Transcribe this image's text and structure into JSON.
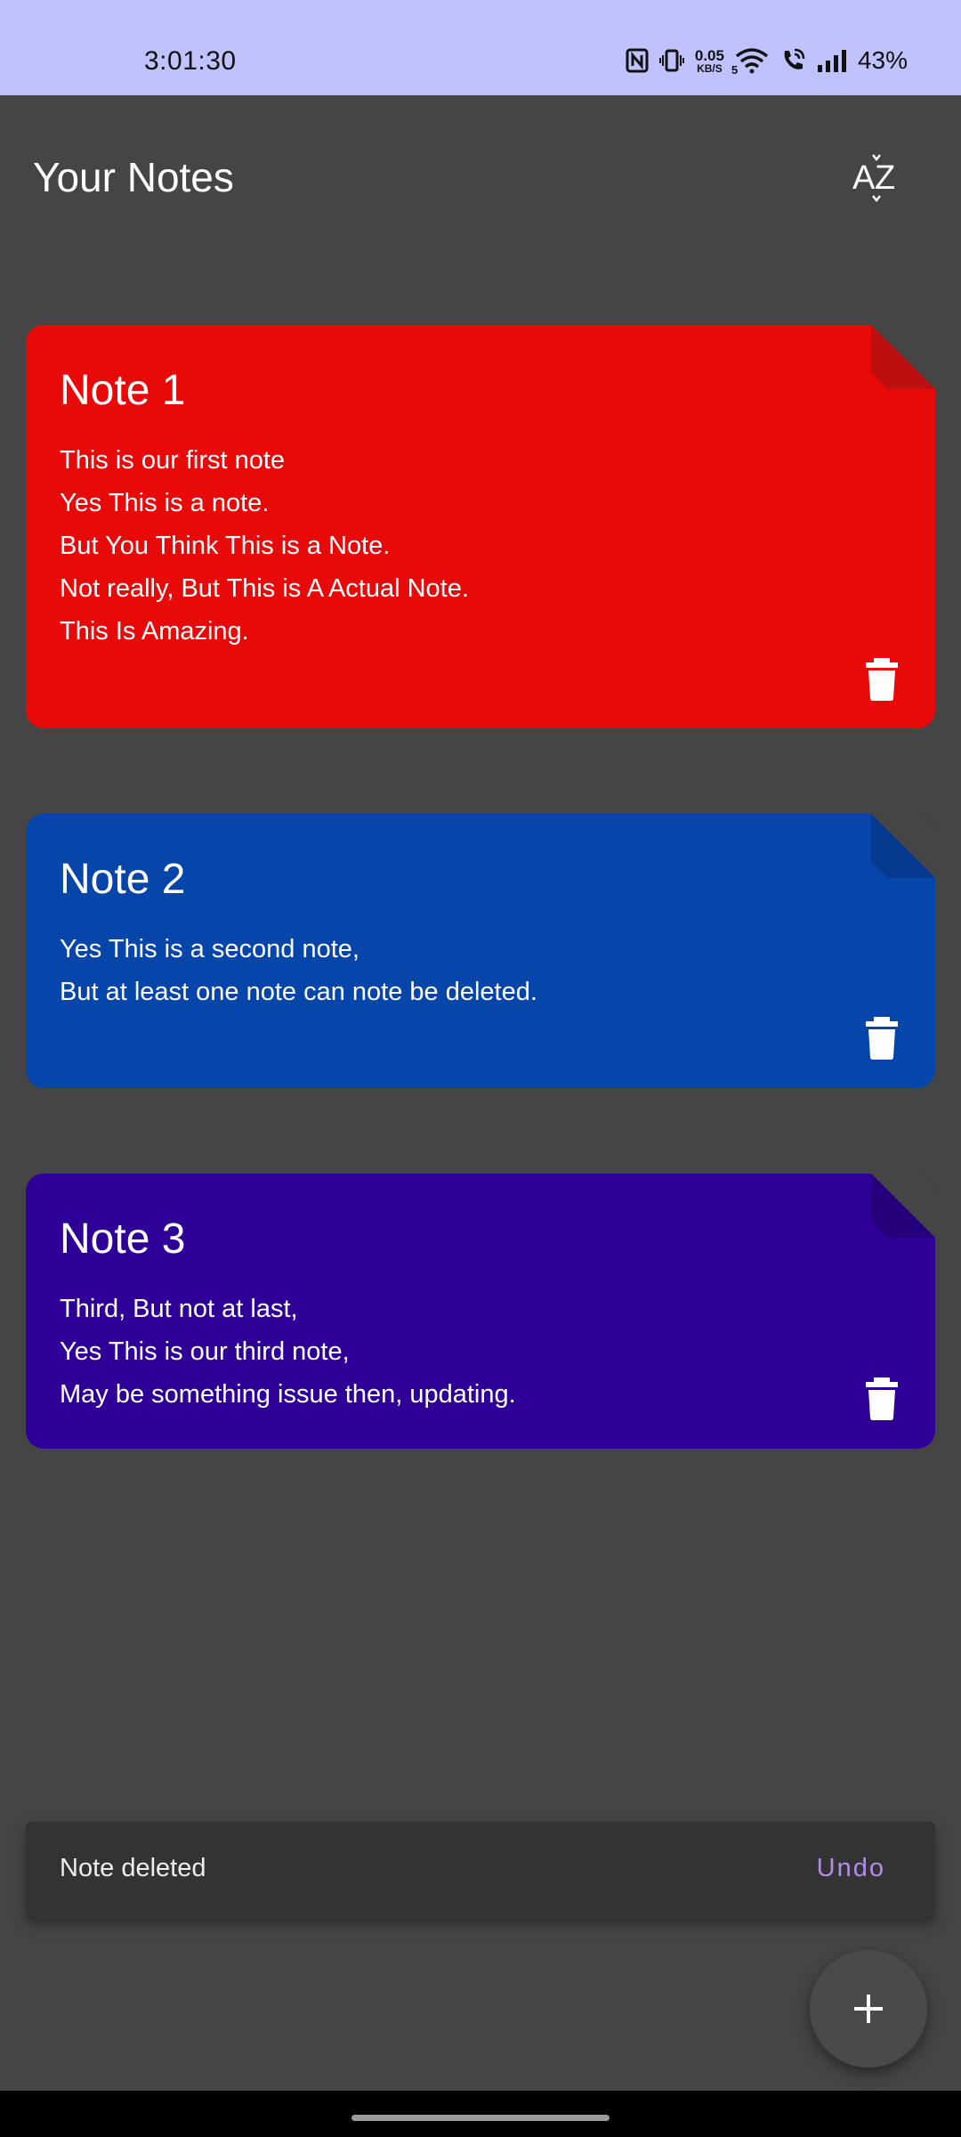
{
  "status_bar": {
    "time": "3:01:30",
    "net_speed_value": "0.05",
    "net_speed_unit": "KB/S",
    "wifi_badge": "5",
    "battery": "43%"
  },
  "header": {
    "title": "Your Notes",
    "sort_icon": "sort-az-icon"
  },
  "notes": [
    {
      "title": "Note 1",
      "lines": [
        "This is our first note",
        "Yes This is a note.",
        "But You Think This is a Note.",
        "Not really, But This is A Actual Note.",
        "This Is Amazing."
      ],
      "color": "#e80909",
      "corner_color": "#bd0f0f"
    },
    {
      "title": "Note 2",
      "lines": [
        "Yes This is a second note,",
        "But at least one note can note be deleted."
      ],
      "color": "#0645a9",
      "corner_color": "#053990"
    },
    {
      "title": "Note 3",
      "lines": [
        "Third, But not at last,",
        "Yes This is our third note,",
        "May be something issue then, updating."
      ],
      "color": "#2f0097",
      "corner_color": "#24007a"
    }
  ],
  "snackbar": {
    "message": "Note deleted",
    "action": "Undo",
    "action_color": "#b08ee6"
  },
  "fab": {
    "icon": "plus-icon"
  }
}
